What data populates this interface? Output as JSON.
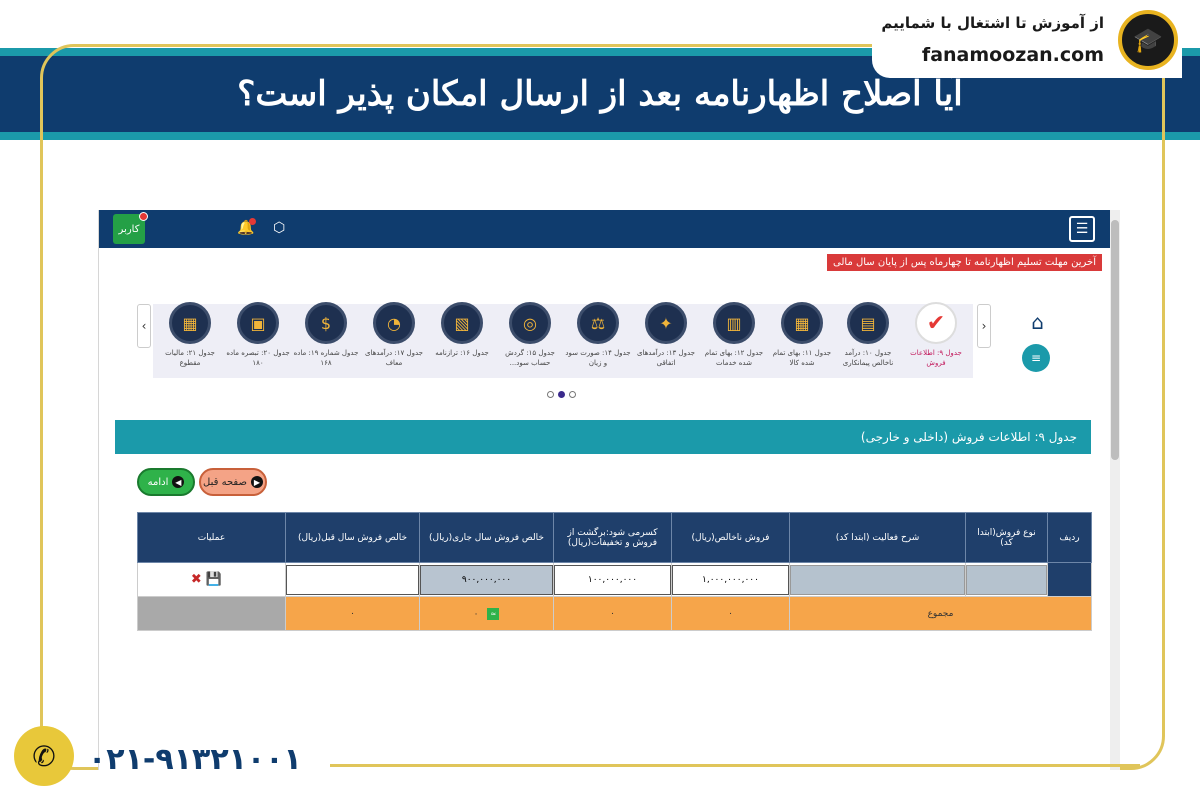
{
  "banner": {
    "headline": "آیا اصلاح اظهارنامه بعد از ارسال امکان پذیر است؟",
    "logo_tagline": "از آموزش تا اشتغال با شماییم",
    "logo_name": "fanamoozan.com",
    "phone": "۰۲۱-۹۱۳۲۱۰۰۱"
  },
  "app": {
    "user_label": "کاربر",
    "alert_text": "آخرین مهلت تسلیم اظهارنامه تا چهارماه پس از پایان سال مالی"
  },
  "icons": [
    {
      "label": "جدول ۹: اطلاعات فروش",
      "active": true
    },
    {
      "label": "جدول ۱۰: درآمد ناخالص پیمانکاری",
      "active": false
    },
    {
      "label": "جدول ۱۱: بهای تمام شده کالا",
      "active": false
    },
    {
      "label": "جدول ۱۲: بهای تمام شده خدمات",
      "active": false
    },
    {
      "label": "جدول ۱۳: درآمدهای اتفاقی",
      "active": false
    },
    {
      "label": "جدول ۱۴: صورت سود و زیان",
      "active": false
    },
    {
      "label": "جدول ۱۵: گردش حساب سود...",
      "active": false
    },
    {
      "label": "جدول ۱۶: ترازنامه",
      "active": false
    },
    {
      "label": "جدول ۱۷: درآمدهای معاف",
      "active": false
    },
    {
      "label": "جدول شماره ۱۹: ماده ۱۶۸",
      "active": false
    },
    {
      "label": "جدول ۲۰: تبصره ماده ۱۸۰",
      "active": false
    },
    {
      "label": "جدول ۲۱: مالیات مقطوع",
      "active": false
    }
  ],
  "section": {
    "title": "جدول ۹: اطلاعات فروش (داخلی و خارجی)",
    "next_label": "ادامه",
    "prev_label": "صفحه قبل"
  },
  "table": {
    "headers": [
      "ردیف",
      "نوع فروش(ابتدا کد)",
      "شرح فعالیت (ابتدا کد)",
      "فروش ناخالص(ریال)",
      "کسرمی شود:برگشت از فروش و تخفیفات(ریال)",
      "خالص فروش سال جاری(ریال)",
      "خالص فروش سال قبل(ریال)",
      "عملیات"
    ],
    "input_row": {
      "gross_sales": "۱,۰۰۰,۰۰۰,۰۰۰",
      "returns": "۱۰۰,۰۰۰,۰۰۰",
      "net_current": "۹۰۰,۰۰۰,۰۰۰",
      "net_previous": ""
    },
    "sum_row": {
      "label": "مجموع",
      "gross": "۰",
      "returns": "۰",
      "net_current": "۰",
      "net_previous": "۰"
    }
  }
}
